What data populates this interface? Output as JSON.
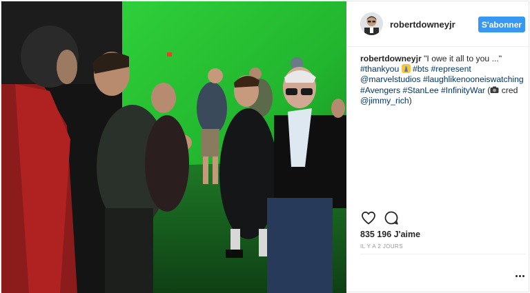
{
  "post": {
    "username": "robertdowneyjr",
    "follow_label": "S'abonner",
    "caption": {
      "author": "robertdowneyjr",
      "quote": " \"I owe it all to you ...\"",
      "line2_tag1": "#thankyou",
      "line2_tag2": "#bts",
      "line2_tag3": "#represent",
      "line3_tag1": "@marvelstudios",
      "line3_tag2": "#laughlikenooneiswatching",
      "line4_tag1": "#Avengers",
      "line4_tag2": "#StanLee",
      "line4_tag3": "#InfinityWar",
      "line4_text": " (",
      "line4_cred": " cred",
      "line5_tag1": "@jimmy_rich",
      "line5_text": ")"
    },
    "likes": "835 196 J'aime",
    "time": "IL Y A 2 JOURS"
  },
  "icons": {
    "like": "heart-icon",
    "comment": "comment-icon",
    "more": "more-options-icon",
    "emoji1": "praying-emoji",
    "emoji2": "camera-emoji"
  },
  "colors": {
    "follow_button": "#3897f0",
    "link": "#003569",
    "text": "#262626",
    "muted": "#999999"
  }
}
